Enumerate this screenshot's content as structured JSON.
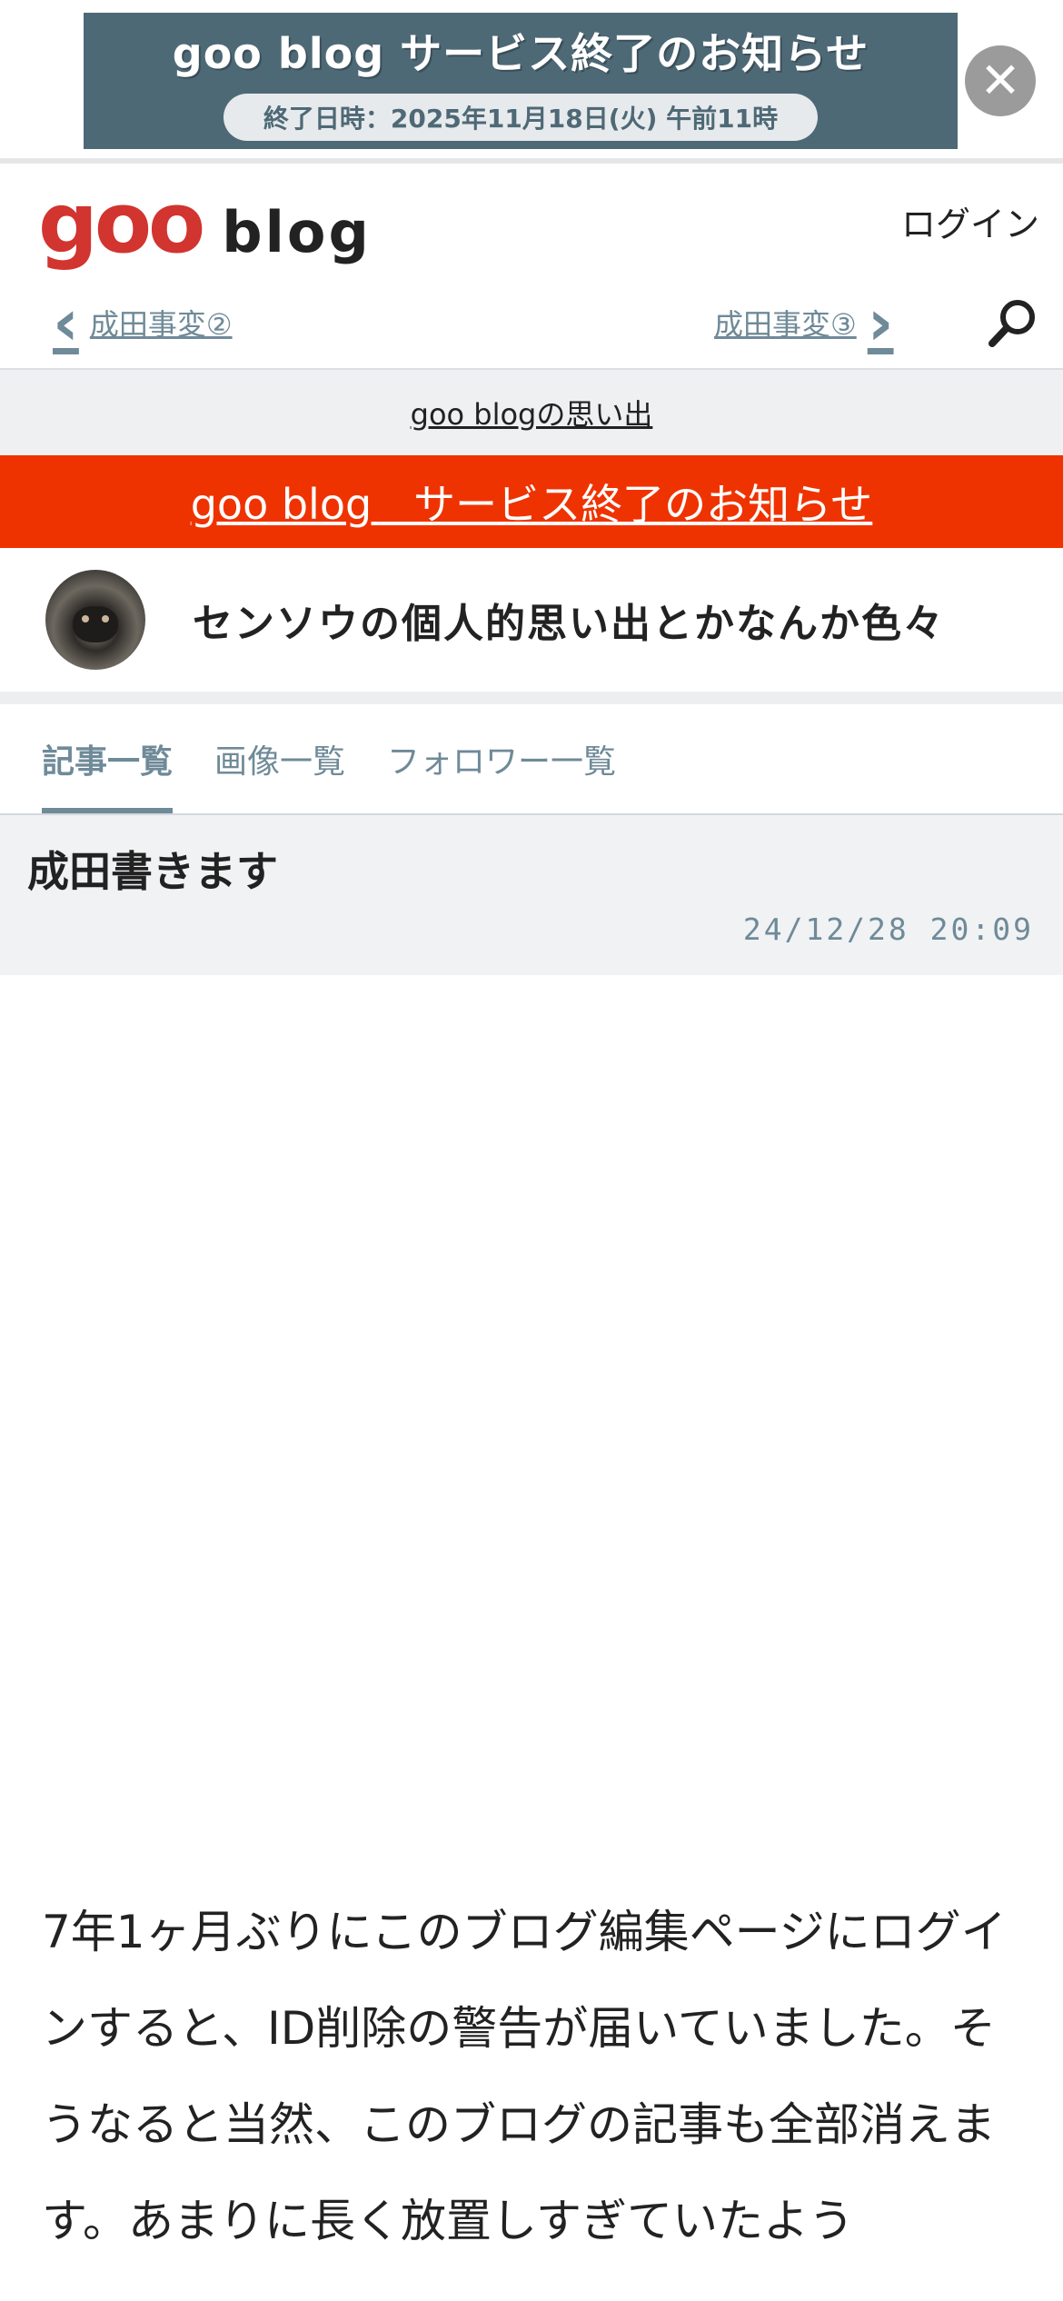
{
  "promo": {
    "title": "goo blog サービス終了のお知らせ",
    "subtitle": "終了日時：2025年11月18日(火) 午前11時",
    "close_label": "✕"
  },
  "header": {
    "logo_goo": "goo",
    "logo_blog": "blog",
    "login_label": "ログイン",
    "prev_post": "成田事変②",
    "next_post": "成田事変③",
    "search_icon": "search-icon"
  },
  "memories_link": "goo blogの思い出",
  "notice_link": "goo blog　サービス終了のお知らせ",
  "blog": {
    "title": "センソウの個人的思い出とかなんか色々"
  },
  "tabs": [
    {
      "label": "記事一覧",
      "active": true
    },
    {
      "label": "画像一覧",
      "active": false
    },
    {
      "label": "フォロワー一覧",
      "active": false
    }
  ],
  "article": {
    "title": "成田書きます",
    "date": "24/12/28 20:09",
    "body": "7年1ヶ月ぶりにこのブログ編集ページにログインすると、ID削除の警告が届いていました。そうなると当然、このブログの記事も全部消えます。あまりに長く放置しすぎていたよう"
  },
  "colors": {
    "accent": "#6f8a98",
    "notice_red": "#ef3300",
    "logo_red": "#d2342f",
    "promo_bg": "#4e6976"
  }
}
